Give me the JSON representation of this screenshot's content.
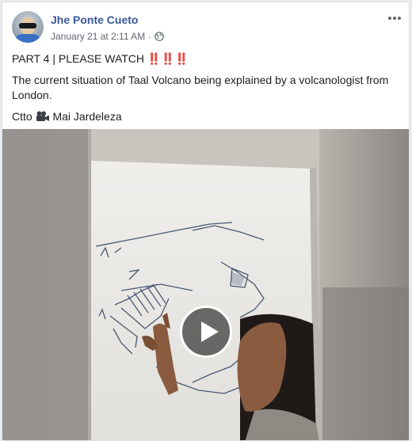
{
  "post": {
    "author": "Jhe Ponte Cueto",
    "timestamp": "January 21 at 2:11 AM",
    "separator": "·",
    "privacy_icon": "globe-icon",
    "more_icon": "more-options-icon"
  },
  "content": {
    "line1_text": "PART 4 | PLEASE WATCH ",
    "line1_emoji": "‼️‼️‼️",
    "line2": "The current situation of Taal Volcano being explained by a volcanologist from London.",
    "line3_prefix": "Ctto ",
    "line3_icon": "video-camera-icon",
    "line3_name": " Mai Jardeleza"
  },
  "video": {
    "play_icon": "play-icon"
  },
  "colors": {
    "author_link": "#385898",
    "meta_text": "#616770",
    "body_text": "#1c1e21",
    "card_border": "#dddfe2",
    "page_bg": "#e9ebee"
  }
}
